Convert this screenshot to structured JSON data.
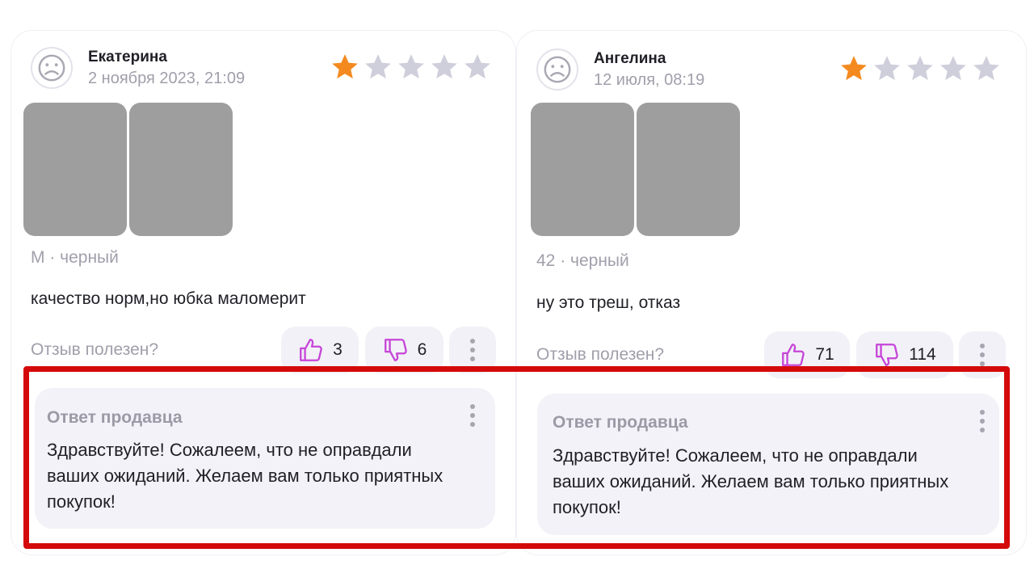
{
  "colors": {
    "accent": "#c646d8",
    "star_active": "#f48a1f",
    "star_inactive": "#cfcedb",
    "highlight": "#d40a0a",
    "photo_placeholder": "#9e9e9e"
  },
  "reviews": [
    {
      "author": "Екатерина",
      "date": "2 ноября 2023, 21:09",
      "rating": 1,
      "rating_max": 5,
      "variant": "M · черный",
      "text": "качество норм,но юбка маломерит",
      "useful_label": "Отзыв полезен?",
      "likes": "3",
      "dislikes": "6",
      "seller_reply": {
        "title": "Ответ продавца",
        "lines": [
          "Здравствуйте! Сожалеем, что не оправдали",
          "ваших ожиданий. Желаем вам только приятных",
          "покупок!"
        ]
      }
    },
    {
      "author": "Ангелина",
      "date": "12 июля, 08:19",
      "rating": 1,
      "rating_max": 5,
      "variant": "42 · черный",
      "text": "ну это треш, отказ",
      "useful_label": "Отзыв полезен?",
      "likes": "71",
      "dislikes": "114",
      "seller_reply": {
        "title": "Ответ продавца",
        "lines": [
          "Здравствуйте! Сожалеем, что не оправдали",
          "ваших ожиданий. Желаем вам только приятных",
          "покупок!"
        ]
      }
    }
  ]
}
